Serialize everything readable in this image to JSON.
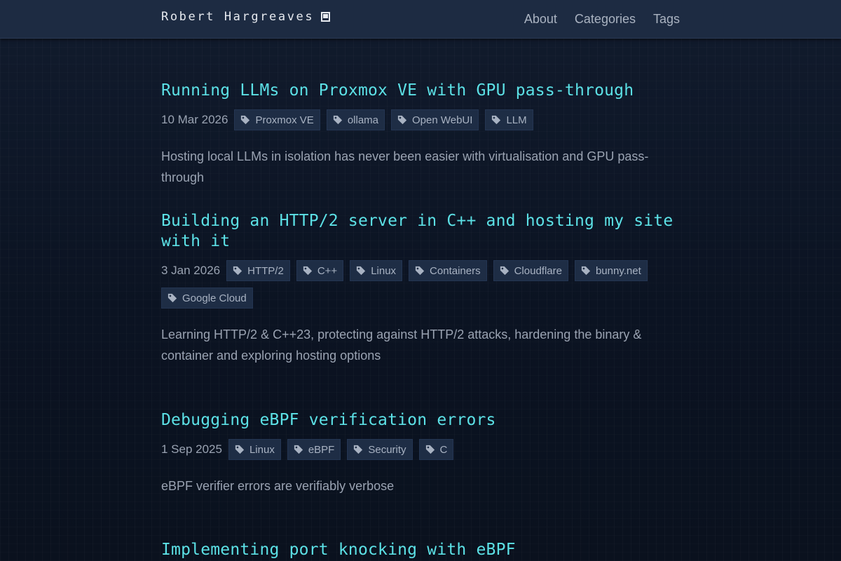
{
  "site": {
    "title": "Robert Hargreaves",
    "nav": [
      "About",
      "Categories",
      "Tags"
    ]
  },
  "posts": [
    {
      "title": "Running LLMs on Proxmox VE with GPU pass-through",
      "date": "10 Mar 2026",
      "tags": [
        "Proxmox VE",
        "ollama",
        "Open WebUI",
        "LLM"
      ],
      "summary": "Hosting local LLMs in isolation has never been easier with virtualisation and GPU pass-through"
    },
    {
      "title": "Building an HTTP/2 server in C++ and hosting my site with it",
      "date": "3 Jan 2026",
      "tags": [
        "HTTP/2",
        "C++",
        "Linux",
        "Containers",
        "Cloudflare",
        "bunny.net",
        "Google Cloud"
      ],
      "summary": "Learning HTTP/2 & C++23, protecting against HTTP/2 attacks, hardening the binary & container and exploring hosting options"
    },
    {
      "title": "Debugging eBPF verification errors",
      "date": "1 Sep 2025",
      "tags": [
        "Linux",
        "eBPF",
        "Security",
        "C"
      ],
      "summary": "eBPF verifier errors are verifiably verbose"
    },
    {
      "title": "Implementing port knocking with eBPF"
    }
  ],
  "colors": {
    "accent": "#5ce1e6",
    "header_bg": "#1d2b42",
    "page_bg": "#0b1220",
    "tag_bg": "#1e2d45"
  },
  "icons": {
    "tag": "tag-icon",
    "book": "book-icon"
  }
}
